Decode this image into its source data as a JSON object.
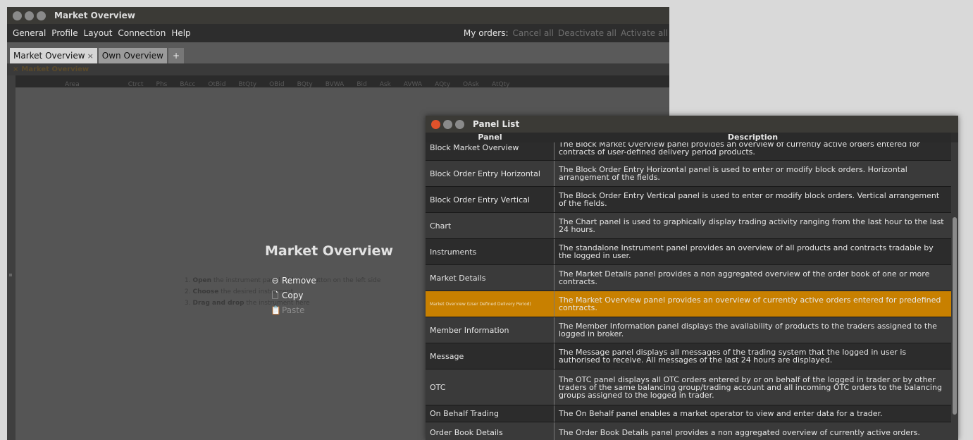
{
  "main": {
    "title": "Market Overview",
    "menu": [
      "General",
      "Profile",
      "Layout",
      "Connection",
      "Help"
    ],
    "orders_label": "My orders:",
    "orders_actions": [
      "Cancel all",
      "Deactivate all",
      "Activate all"
    ],
    "tabs": [
      {
        "label": "Market Overview",
        "close": "×"
      },
      {
        "label": "Own Overview"
      }
    ],
    "tab_add": "+",
    "panel_header": "Market Overview",
    "column_headers": [
      "Area",
      "Ctrct",
      "Phs",
      "BAcc",
      "OtBid",
      "BtQty",
      "OBid",
      "BQty",
      "BVWA",
      "Bid",
      "Ask",
      "AVWA",
      "AQty",
      "OAsk",
      "AtQty"
    ],
    "content_title": "Market Overview",
    "steps": [
      {
        "num": "1.",
        "bold": "Open",
        "text": "the instrument panel with the",
        "tail": "button on the left side"
      },
      {
        "num": "2.",
        "bold": "Choose",
        "text": "the desired instrument",
        "tail": ""
      },
      {
        "num": "3.",
        "bold": "Drag and drop",
        "text": "the instrument here",
        "tail": ""
      }
    ],
    "context_menu": {
      "remove": "Remove",
      "copy": "Copy",
      "paste": "Paste"
    }
  },
  "dialog": {
    "title": "Panel List",
    "col_panel": "Panel",
    "col_desc": "Description",
    "rows": [
      {
        "panel": "Block Market Overview",
        "desc": "The Block Market Overview panel provides an overview of currently active orders entered for contracts of user-defined delivery period products."
      },
      {
        "panel": "Block Order Entry Horizontal",
        "desc": "The Block Order Entry Horizontal panel is used to enter or modify block orders. Horizontal arrangement of the fields."
      },
      {
        "panel": "Block Order Entry Vertical",
        "desc": "The Block Order Entry Vertical panel is used to enter or modify block orders. Vertical arrangement of the fields."
      },
      {
        "panel": "Chart",
        "desc": "The Chart panel is used to graphically display trading activity ranging from the last hour to the last 24 hours."
      },
      {
        "panel": "Instruments",
        "desc": "The standalone Instrument panel provides an overview of all products and contracts tradable by the logged in user."
      },
      {
        "panel": "Market Details",
        "desc": "The Market Details panel provides a non aggregated overview of the order book of one or more contracts."
      },
      {
        "panel": "Market Overview (User Defined Delivery Period)",
        "desc": "The Market Overview panel provides an overview of currently active orders entered for predefined contracts.",
        "selected": true
      },
      {
        "panel": "Member Information",
        "desc": "The Member Information panel displays the availability of products to the traders assigned to the logged in broker."
      },
      {
        "panel": "Message",
        "desc": "The Message panel displays all messages of the trading system that the logged in user is authorised to receive. All messages of the last 24 hours are displayed."
      },
      {
        "panel": "OTC",
        "desc": "The OTC panel displays all OTC orders entered by or on behalf of the logged in trader or by other traders of the same balancing group/trading account and all incoming OTC orders to the balancing groups assigned to the logged in trader."
      },
      {
        "panel": "On Behalf Trading",
        "desc": "The On Behalf panel enables a market operator to view and enter data for a trader."
      },
      {
        "panel": "Order Book Details",
        "desc": "The Order Book Details panel provides a non aggregated overview of currently active orders."
      }
    ]
  }
}
